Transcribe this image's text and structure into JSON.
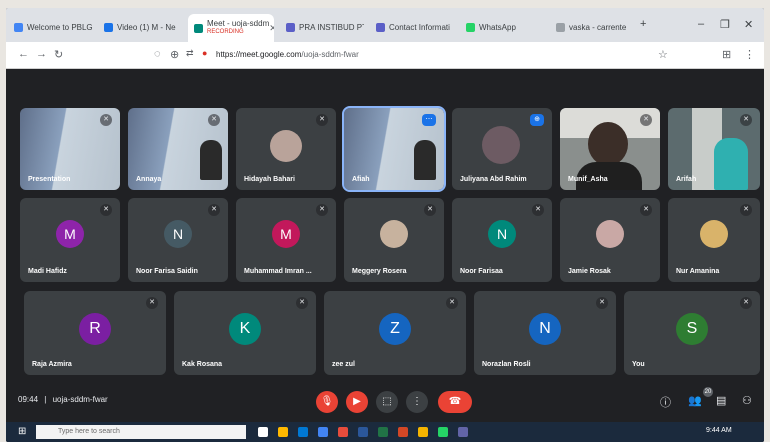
{
  "browser": {
    "tabs": [
      {
        "label": "Welcome to PBLG",
        "color": "#4285f4"
      },
      {
        "label": "Video (1) M - Ne",
        "color": "#1a73e8"
      },
      {
        "label": "Meet - uoja-sddm",
        "sub": "RECORDING",
        "color": "#00897b"
      },
      {
        "label": "PRA INSTIBUD PT",
        "color": "#5b5fc7"
      },
      {
        "label": "Contact Informati",
        "color": "#5b5fc7"
      },
      {
        "label": "WhatsApp",
        "color": "#25d366"
      },
      {
        "label": "vaska - carrente",
        "color": "#9aa0a6"
      }
    ],
    "new_tab": "+",
    "url_host": "https://meet.google.com",
    "url_path": "/uoja-sddm-fwar"
  },
  "tiles": [
    {
      "name": "Presentation",
      "kind": "shared"
    },
    {
      "name": "Annaya",
      "kind": "shared-person"
    },
    {
      "name": "Hidayah Bahari",
      "kind": "photo",
      "color": "#b9a39a"
    },
    {
      "name": "Afiah",
      "kind": "shared-person",
      "speaking": true
    },
    {
      "name": "Juliyana Abd Rahim",
      "kind": "photo",
      "color": "#6d5b63",
      "pinned": true
    },
    {
      "name": "Munif_Asha",
      "kind": "video"
    },
    {
      "name": "Arifah",
      "kind": "video2"
    },
    {
      "name": "Madi Hafidz",
      "initial": "M",
      "color": "#8e24aa"
    },
    {
      "name": "Noor Farisa Saidin",
      "initial": "N",
      "color": "#455a64"
    },
    {
      "name": "Muhammad Imran ...",
      "initial": "M",
      "color": "#c2185b"
    },
    {
      "name": "Meggery Rosera",
      "kind": "photo",
      "color": "#c7b29e"
    },
    {
      "name": "Noor Farisaa",
      "initial": "N",
      "color": "#00897b"
    },
    {
      "name": "Jamie Rosak",
      "kind": "photo",
      "color": "#c9a8a5"
    },
    {
      "name": "Nur Amanina",
      "kind": "photo",
      "color": "#d9b36a"
    },
    {
      "name": "Raja Azmira",
      "initial": "R",
      "color": "#7b1fa2"
    },
    {
      "name": "Kak Rosana",
      "initial": "K",
      "color": "#00897b"
    },
    {
      "name": "zee zul",
      "initial": "Z",
      "color": "#1565c0"
    },
    {
      "name": "Norazlan Rosli",
      "initial": "N",
      "color": "#1565c0"
    },
    {
      "name": "You",
      "initial": "S",
      "color": "#2e7d32"
    }
  ],
  "bottom_bar": {
    "time": "09:44",
    "separator": "|",
    "meeting_code": "uoja-sddm-fwar",
    "participants_count": "20"
  },
  "taskbar": {
    "search_placeholder": "Type here to search",
    "clock": "9:44 AM"
  }
}
